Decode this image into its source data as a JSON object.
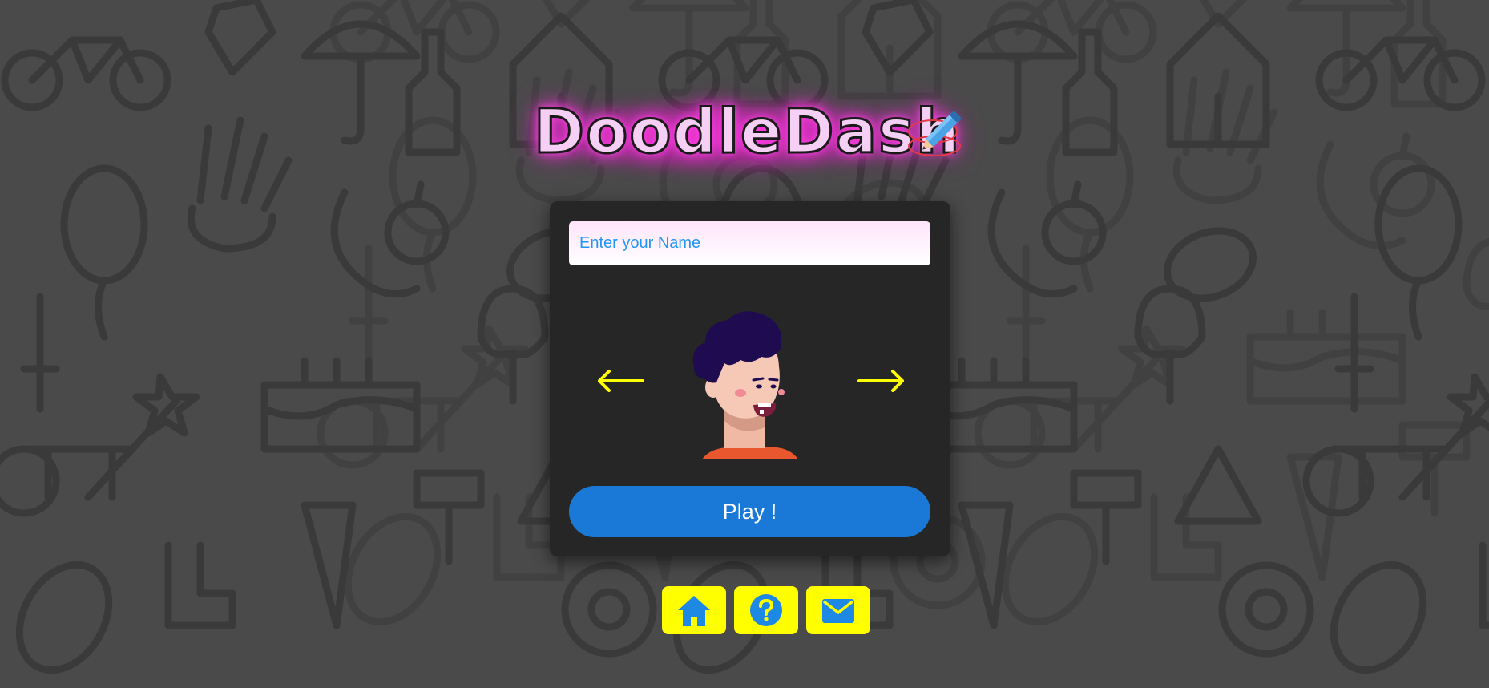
{
  "app": {
    "title": "DoodleDash"
  },
  "colors": {
    "background": "#4a4a4a",
    "doodle_stroke": "#3a3a3a",
    "panel": "#262626",
    "accent_glow": "#ff3fe3",
    "play_button": "#1a78d6",
    "footer_button": "#ffff00",
    "footer_icon": "#1e88e5",
    "arrow": "#ffff00",
    "placeholder_text": "#2196f3"
  },
  "login": {
    "name_placeholder": "Enter your Name",
    "name_value": "",
    "play_label": "Play !"
  },
  "avatar": {
    "prev_icon": "arrow-left-icon",
    "next_icon": "arrow-right-icon",
    "character": "boy-avatar"
  },
  "footer": {
    "buttons": [
      {
        "icon": "home-icon"
      },
      {
        "icon": "help-icon"
      },
      {
        "icon": "mail-icon"
      }
    ]
  }
}
